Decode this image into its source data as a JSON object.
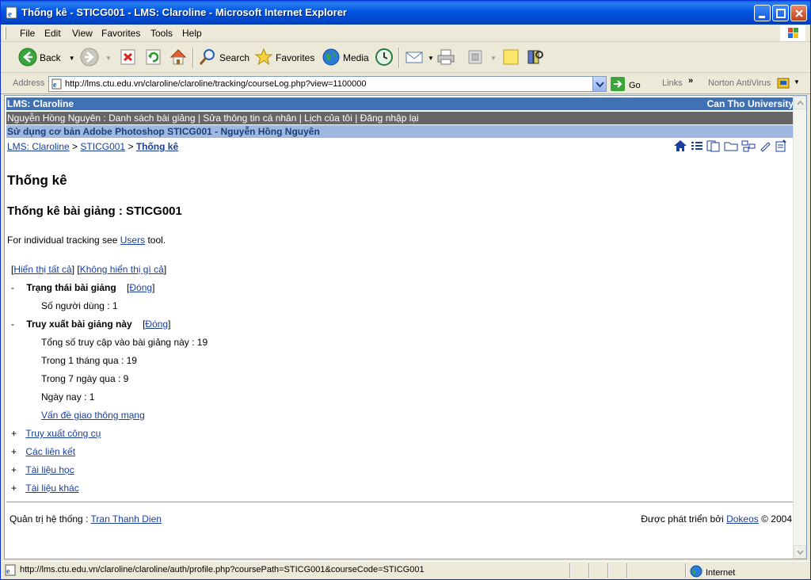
{
  "window": {
    "title": "Thống kê - STICG001 - LMS: Claroline - Microsoft Internet Explorer"
  },
  "menu": {
    "items": [
      "File",
      "Edit",
      "View",
      "Favorites",
      "Tools",
      "Help"
    ]
  },
  "toolbar": {
    "back_label": "Back",
    "search_label": "Search",
    "favorites_label": "Favorites",
    "media_label": "Media"
  },
  "address": {
    "label": "Address",
    "url": "http://lms.ctu.edu.vn/claroline/claroline/tracking/courseLog.php?view=1100000",
    "go_label": "Go",
    "links_label": "Links",
    "norton_label": "Norton AntiVirus"
  },
  "page": {
    "site_name": "LMS: Claroline",
    "institution": "Can Tho University",
    "user_bar": "Nguyễn Hồng Nguyên : Danh sách bài giảng | Sửa thông tin cá nhân | Lịch của tôi | Đăng nhập lại",
    "course_title": "Sử dụng cơ bản Adobe Photoshop STICG001 - Nguyễn Hồng Nguyên",
    "breadcrumb": {
      "root": "LMS: Claroline",
      "sep": ">",
      "course": "STICG001",
      "current": "Thống kê"
    },
    "heading": "Thống kê",
    "subheading": "Thống kê bài giảng : STICG001",
    "intro_prefix": "For individual tracking see",
    "intro_link": "Users",
    "intro_suffix": "tool.",
    "show_all": "Hiển thị tất cả",
    "show_none": "Không hiển thị gì cả",
    "sections": {
      "status": {
        "marker": "-",
        "title": "Trạng thái bài giảng",
        "close": "Đóng",
        "users_line": "Số người dùng : 1"
      },
      "access": {
        "marker": "-",
        "title": "Truy xuất bài giảng này",
        "close": "Đóng",
        "total": "Tổng số truy cập vào bài giảng này : 19",
        "month": "Trong 1 tháng qua : 19",
        "week": "Trong 7 ngày qua : 9",
        "today": "Ngày nay : 1",
        "traffic_link": "Vấn đề giao thông mạng"
      },
      "collapsed": [
        {
          "marker": "+",
          "label": "Truy xuất công cụ"
        },
        {
          "marker": "+",
          "label": "Các liên kết"
        },
        {
          "marker": "+",
          "label": "Tài liệu học"
        },
        {
          "marker": "+",
          "label": "Tài liệu khác"
        }
      ]
    },
    "footer": {
      "admin_prefix": "Quản trị hệ thống :",
      "admin_name": "Tran Thanh Dien",
      "powered_prefix": "Được phát triển bởi",
      "powered_link": "Dokeos",
      "powered_suffix": "© 2004"
    }
  },
  "status": {
    "url": "http://lms.ctu.edu.vn/claroline/claroline/auth/profile.php?coursePath=STICG001&courseCode=STICG001",
    "zone": "Internet"
  },
  "colors": {
    "header_blue": "#4171b5",
    "user_bar_gray": "#666666",
    "course_bar": "#9fb8df",
    "link": "#1a3f9c"
  }
}
